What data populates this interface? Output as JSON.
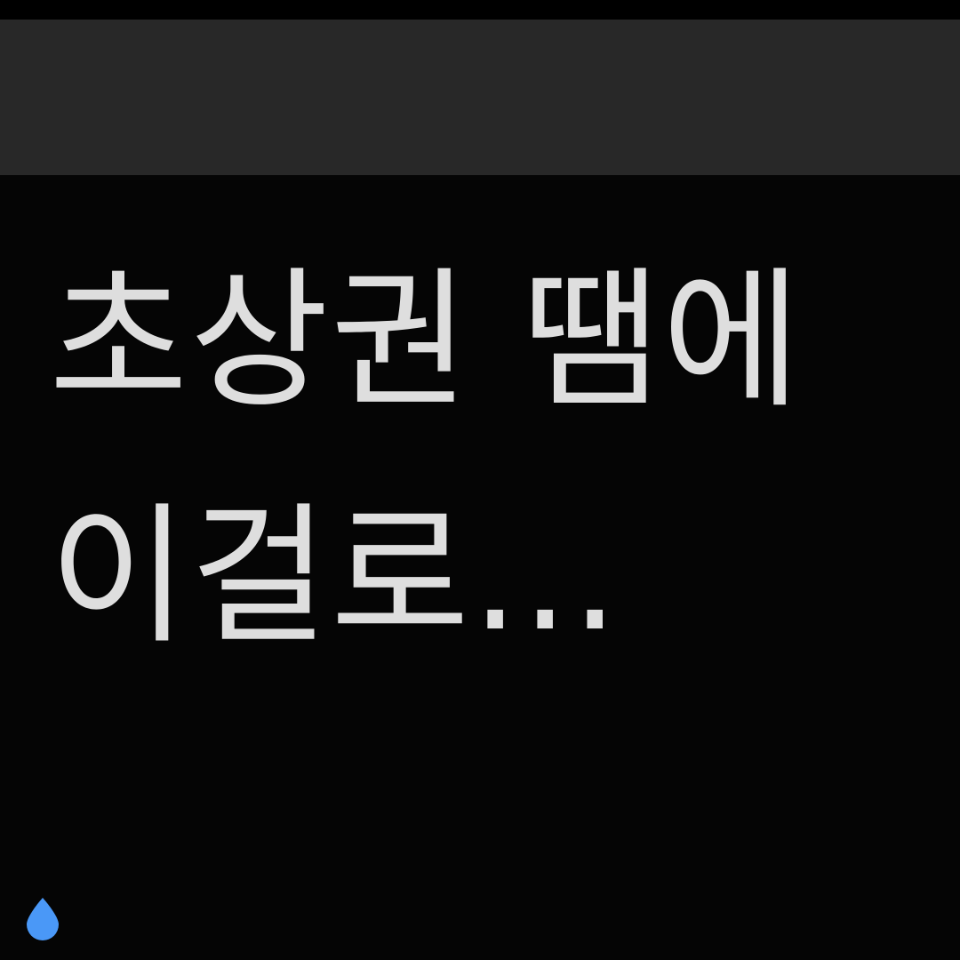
{
  "caption": {
    "text": "초상권 땜에\n이걸로..."
  },
  "icons": {
    "drop": "water-drop-icon"
  },
  "colors": {
    "background": "#050505",
    "header_bar": "#282828",
    "caption_text": "#dedede",
    "drop_accent": "#4a98f7"
  }
}
